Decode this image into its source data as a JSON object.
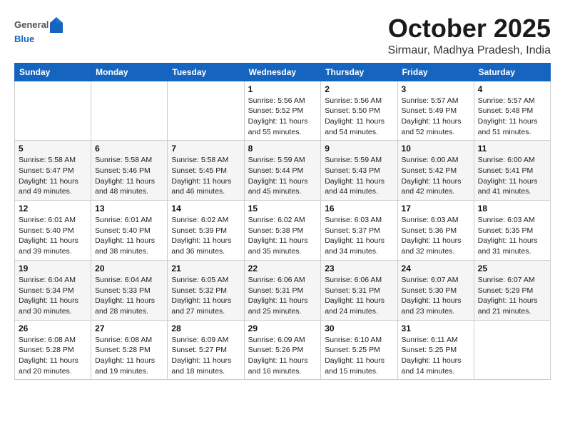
{
  "header": {
    "logo_line1": "General",
    "logo_line2": "Blue",
    "month": "October 2025",
    "location": "Sirmaur, Madhya Pradesh, India"
  },
  "weekdays": [
    "Sunday",
    "Monday",
    "Tuesday",
    "Wednesday",
    "Thursday",
    "Friday",
    "Saturday"
  ],
  "weeks": [
    [
      {
        "day": "",
        "info": ""
      },
      {
        "day": "",
        "info": ""
      },
      {
        "day": "",
        "info": ""
      },
      {
        "day": "1",
        "info": "Sunrise: 5:56 AM\nSunset: 5:52 PM\nDaylight: 11 hours and 55 minutes."
      },
      {
        "day": "2",
        "info": "Sunrise: 5:56 AM\nSunset: 5:50 PM\nDaylight: 11 hours and 54 minutes."
      },
      {
        "day": "3",
        "info": "Sunrise: 5:57 AM\nSunset: 5:49 PM\nDaylight: 11 hours and 52 minutes."
      },
      {
        "day": "4",
        "info": "Sunrise: 5:57 AM\nSunset: 5:48 PM\nDaylight: 11 hours and 51 minutes."
      }
    ],
    [
      {
        "day": "5",
        "info": "Sunrise: 5:58 AM\nSunset: 5:47 PM\nDaylight: 11 hours and 49 minutes."
      },
      {
        "day": "6",
        "info": "Sunrise: 5:58 AM\nSunset: 5:46 PM\nDaylight: 11 hours and 48 minutes."
      },
      {
        "day": "7",
        "info": "Sunrise: 5:58 AM\nSunset: 5:45 PM\nDaylight: 11 hours and 46 minutes."
      },
      {
        "day": "8",
        "info": "Sunrise: 5:59 AM\nSunset: 5:44 PM\nDaylight: 11 hours and 45 minutes."
      },
      {
        "day": "9",
        "info": "Sunrise: 5:59 AM\nSunset: 5:43 PM\nDaylight: 11 hours and 44 minutes."
      },
      {
        "day": "10",
        "info": "Sunrise: 6:00 AM\nSunset: 5:42 PM\nDaylight: 11 hours and 42 minutes."
      },
      {
        "day": "11",
        "info": "Sunrise: 6:00 AM\nSunset: 5:41 PM\nDaylight: 11 hours and 41 minutes."
      }
    ],
    [
      {
        "day": "12",
        "info": "Sunrise: 6:01 AM\nSunset: 5:40 PM\nDaylight: 11 hours and 39 minutes."
      },
      {
        "day": "13",
        "info": "Sunrise: 6:01 AM\nSunset: 5:40 PM\nDaylight: 11 hours and 38 minutes."
      },
      {
        "day": "14",
        "info": "Sunrise: 6:02 AM\nSunset: 5:39 PM\nDaylight: 11 hours and 36 minutes."
      },
      {
        "day": "15",
        "info": "Sunrise: 6:02 AM\nSunset: 5:38 PM\nDaylight: 11 hours and 35 minutes."
      },
      {
        "day": "16",
        "info": "Sunrise: 6:03 AM\nSunset: 5:37 PM\nDaylight: 11 hours and 34 minutes."
      },
      {
        "day": "17",
        "info": "Sunrise: 6:03 AM\nSunset: 5:36 PM\nDaylight: 11 hours and 32 minutes."
      },
      {
        "day": "18",
        "info": "Sunrise: 6:03 AM\nSunset: 5:35 PM\nDaylight: 11 hours and 31 minutes."
      }
    ],
    [
      {
        "day": "19",
        "info": "Sunrise: 6:04 AM\nSunset: 5:34 PM\nDaylight: 11 hours and 30 minutes."
      },
      {
        "day": "20",
        "info": "Sunrise: 6:04 AM\nSunset: 5:33 PM\nDaylight: 11 hours and 28 minutes."
      },
      {
        "day": "21",
        "info": "Sunrise: 6:05 AM\nSunset: 5:32 PM\nDaylight: 11 hours and 27 minutes."
      },
      {
        "day": "22",
        "info": "Sunrise: 6:06 AM\nSunset: 5:31 PM\nDaylight: 11 hours and 25 minutes."
      },
      {
        "day": "23",
        "info": "Sunrise: 6:06 AM\nSunset: 5:31 PM\nDaylight: 11 hours and 24 minutes."
      },
      {
        "day": "24",
        "info": "Sunrise: 6:07 AM\nSunset: 5:30 PM\nDaylight: 11 hours and 23 minutes."
      },
      {
        "day": "25",
        "info": "Sunrise: 6:07 AM\nSunset: 5:29 PM\nDaylight: 11 hours and 21 minutes."
      }
    ],
    [
      {
        "day": "26",
        "info": "Sunrise: 6:08 AM\nSunset: 5:28 PM\nDaylight: 11 hours and 20 minutes."
      },
      {
        "day": "27",
        "info": "Sunrise: 6:08 AM\nSunset: 5:28 PM\nDaylight: 11 hours and 19 minutes."
      },
      {
        "day": "28",
        "info": "Sunrise: 6:09 AM\nSunset: 5:27 PM\nDaylight: 11 hours and 18 minutes."
      },
      {
        "day": "29",
        "info": "Sunrise: 6:09 AM\nSunset: 5:26 PM\nDaylight: 11 hours and 16 minutes."
      },
      {
        "day": "30",
        "info": "Sunrise: 6:10 AM\nSunset: 5:25 PM\nDaylight: 11 hours and 15 minutes."
      },
      {
        "day": "31",
        "info": "Sunrise: 6:11 AM\nSunset: 5:25 PM\nDaylight: 11 hours and 14 minutes."
      },
      {
        "day": "",
        "info": ""
      }
    ]
  ]
}
